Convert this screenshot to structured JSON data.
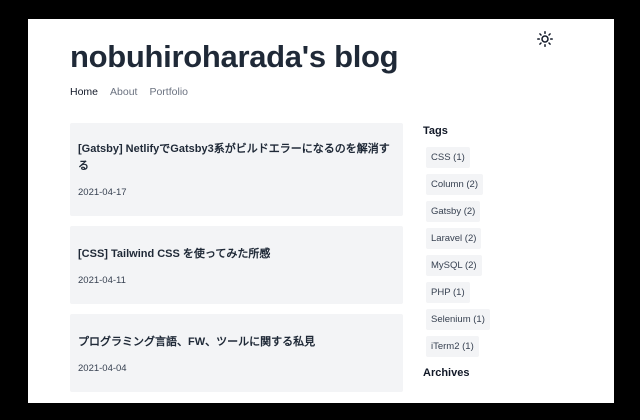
{
  "site": {
    "title": "nobuhiroharada's blog",
    "theme_toggle_icon": "sun-icon"
  },
  "nav": [
    {
      "label": "Home",
      "active": true
    },
    {
      "label": "About",
      "active": false
    },
    {
      "label": "Portfolio",
      "active": false
    }
  ],
  "posts": [
    {
      "title": "[Gatsby] NetlifyでGatsby3系がビルドエラーになるのを解消する",
      "date": "2021-04-17"
    },
    {
      "title": "[CSS] Tailwind CSS を使ってみた所感",
      "date": "2021-04-11"
    },
    {
      "title": "プログラミング言語、FW、ツールに関する私見",
      "date": "2021-04-04"
    }
  ],
  "sidebar": {
    "tags_heading": "Tags",
    "tags": [
      "CSS (1)",
      "Column (2)",
      "Gatsby (2)",
      "Laravel (2)",
      "MySQL (2)",
      "PHP (1)",
      "Selenium (1)",
      "iTerm2 (1)"
    ],
    "archives_heading": "Archives"
  },
  "colors": {
    "card_bg": "#f3f4f6",
    "title_text": "#1f2937",
    "nav_muted": "#6b7280",
    "frame": "#000000"
  }
}
